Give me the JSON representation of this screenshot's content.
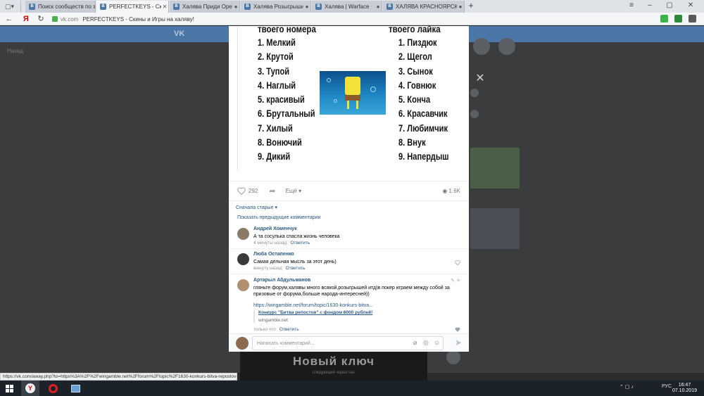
{
  "browser": {
    "tabs": [
      {
        "label": "Поиск сообществ по запросу",
        "icon": "vk-icon"
      },
      {
        "label": "PERFECTKEYS - Скины и",
        "icon": "vk-icon",
        "active": true
      },
      {
        "label": "Халява Приди Оренбург",
        "icon": "vk-icon"
      },
      {
        "label": "Халява Розыгрыши Ключ",
        "icon": "vk-icon"
      },
      {
        "label": "Халява | Warface",
        "icon": "vk-icon"
      },
      {
        "label": "ХАЛЯВА КРАСНОЯРСК",
        "icon": "vk-icon"
      }
    ],
    "new_tab": "+",
    "address": {
      "domain": "vk.com",
      "title": "PERFECTKEYS - Скины и Игры на халяву!"
    },
    "status_url": "https://vk.com/away.php?to=https%3A%2F%2Fwingamble.net%2Fforum%2Ftopic%2F1630-konkurs-bitva-repostov-s-f"
  },
  "post": {
    "left_head": "твоего номера",
    "right_head": "твоего лайка",
    "left_list": [
      "1. Мелкий",
      "2. Крутой",
      "3. Тупой",
      "4. Наглый",
      "5. красивый",
      "6. Брутальный",
      "7. Хилый",
      "8. Вонючий",
      "9. Дикий"
    ],
    "right_list": [
      "1. Пиздюк",
      "2. Щегол",
      "3. Сынок",
      "4. Говнюк",
      "5. Конча",
      "6. Красавчик",
      "7. Любимчик",
      "8. Внук",
      "9. Напердыш"
    ],
    "likes": "292",
    "more_label": "Ещё",
    "views": "1.6K"
  },
  "comments_section": {
    "sort_label": "Сначала старые",
    "show_prev": "Показать предыдущие комментарии",
    "comments": [
      {
        "name": "Андрей Хоменчук",
        "text": "А та сосулька спасла жизнь человека",
        "time": "4 минуты назад",
        "reply": "Ответить"
      },
      {
        "name": "Люба Остапенко",
        "text": "Самая дельная мысль за этот день)",
        "time": "минуту назад",
        "reply": "Ответить"
      },
      {
        "name": "Артарыл Абдульманов",
        "text": "гляньте форум,халявы много всякой,розыгрышей итд)в покер играем между собой за призовые от форума,больше народа-интересней))",
        "link": "https://wingamble.net/forum/topic/1630-konkurs-bitva...",
        "snippet_title": "Конкурс \"Битва репостов\" с фондом 6000 рублей!",
        "snippet_domain": "wingamble.net",
        "time": "только что",
        "reply": "Ответить"
      }
    ],
    "compose_placeholder": "Написать комментарий..."
  },
  "background_page": {
    "back_label": "Назад",
    "promo_title": "Новый ключ",
    "promo_sub": "следующий через час"
  },
  "taskbar": {
    "lang": "РУС",
    "time": "16:47",
    "date": "07.10.2019"
  }
}
